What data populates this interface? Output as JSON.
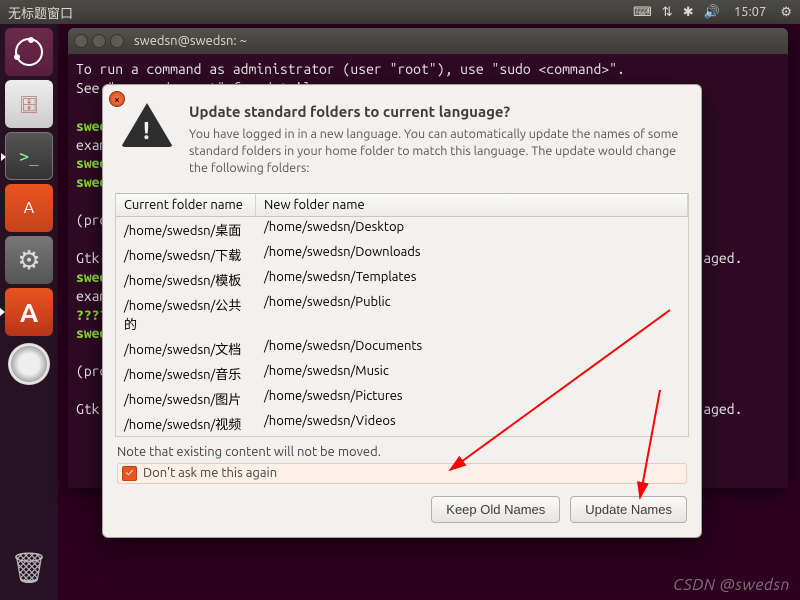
{
  "menubar": {
    "title": "无标题窗口",
    "clock": "15:07"
  },
  "terminal": {
    "title": "swedsn@swedsn: ~",
    "line1": "To run a command as administrator (user \"root\"), use \"sudo <command>\".",
    "line2": "See \"man sudo_root\" for details.",
    "prompt": "swedsn@swedsn",
    "tilde": "~",
    "frag_swed": "swed",
    "frag_exam": "exam",
    "frag_q": "????",
    "frag_pro": "(pro",
    "frag_gtk": "Gtk-",
    "frag_uraged": "uraged."
  },
  "dialog": {
    "title": "Update standard folders to current language?",
    "desc": "You have logged in in a new language. You can automatically update the names of some standard folders in your home folder to match this language. The update would change the following folders:",
    "col_current": "Current folder name",
    "col_new": "New folder name",
    "rows": [
      {
        "cur": "/home/swedsn/桌面",
        "new": "/home/swedsn/Desktop"
      },
      {
        "cur": "/home/swedsn/下载",
        "new": "/home/swedsn/Downloads"
      },
      {
        "cur": "/home/swedsn/模板",
        "new": "/home/swedsn/Templates"
      },
      {
        "cur": "/home/swedsn/公共的",
        "new": "/home/swedsn/Public"
      },
      {
        "cur": "/home/swedsn/文档",
        "new": "/home/swedsn/Documents"
      },
      {
        "cur": "/home/swedsn/音乐",
        "new": "/home/swedsn/Music"
      },
      {
        "cur": "/home/swedsn/图片",
        "new": "/home/swedsn/Pictures"
      },
      {
        "cur": "/home/swedsn/视频",
        "new": "/home/swedsn/Videos"
      }
    ],
    "note": "Note that existing content will not be moved.",
    "checkbox_label": "Don't ask me this again",
    "checkbox_checked": true,
    "btn_keep": "Keep Old Names",
    "btn_update": "Update Names"
  },
  "watermark": "CSDN @swedsn"
}
